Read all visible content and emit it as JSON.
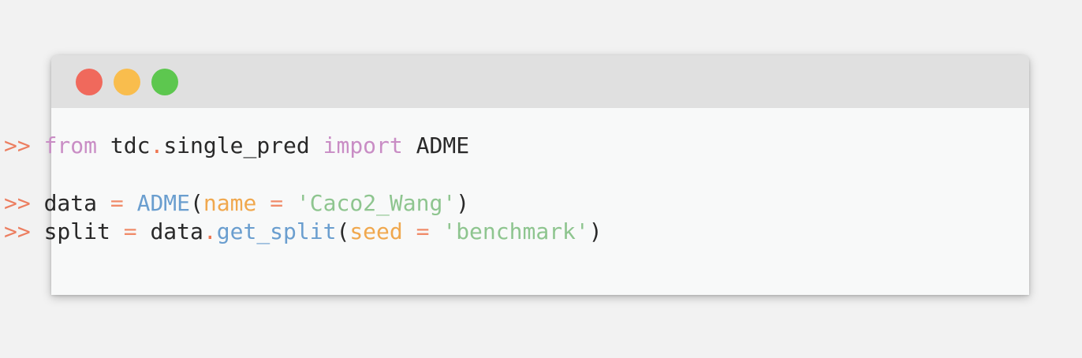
{
  "window": {
    "controls": [
      "close",
      "minimize",
      "maximize"
    ],
    "colors": {
      "close": "#f0695c",
      "minimize": "#f9bd4d",
      "maximize": "#5dc74f",
      "titlebar": "#e0e0e0",
      "background": "#f8f9f9"
    }
  },
  "code": {
    "line1": {
      "prompt": ">>",
      "kw_from": "from",
      "module_a": "tdc",
      "dot": ".",
      "module_b": "single_pred",
      "kw_import": "import",
      "name": "ADME"
    },
    "line2": {
      "prompt": ">>",
      "var": "data",
      "eq": "=",
      "call": "ADME",
      "open": "(",
      "param": "name",
      "eq2": "=",
      "string": "'Caco2_Wang'",
      "close": ")"
    },
    "line3": {
      "prompt": ">>",
      "var": "split",
      "eq": "=",
      "obj": "data",
      "dot": ".",
      "method": "get_split",
      "open": "(",
      "param": "seed",
      "eq2": "=",
      "string": "'benchmark'",
      "close": ")"
    }
  }
}
